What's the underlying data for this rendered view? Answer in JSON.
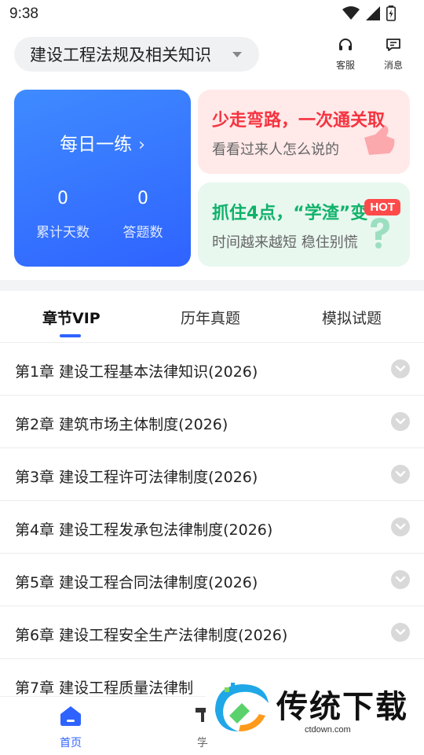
{
  "status_bar": {
    "time": "9:38"
  },
  "header": {
    "subject": "建设工程法规及相关知识",
    "service_label": "客服",
    "message_label": "消息"
  },
  "daily_card": {
    "title": "每日一练",
    "stats": [
      {
        "value": "0",
        "caption": "累计天数"
      },
      {
        "value": "0",
        "caption": "答题数"
      }
    ]
  },
  "promos": [
    {
      "title": "少走弯路，一次通关取",
      "subtitle": "看看过来人怎么说的"
    },
    {
      "title": "抓住4点，“学渣”变",
      "subtitle": "时间越来越短 稳住别慌",
      "badge": "HOT"
    }
  ],
  "tabs": [
    {
      "label": "章节VIP",
      "active": true
    },
    {
      "label": "历年真题",
      "active": false
    },
    {
      "label": "模拟试题",
      "active": false
    }
  ],
  "chapters": [
    "第1章  建设工程基本法律知识(2026)",
    "第2章  建筑市场主体制度(2026)",
    "第3章  建设工程许可法律制度(2026)",
    "第4章  建设工程发承包法律制度(2026)",
    "第5章  建设工程合同法律制度(2026)",
    "第6章  建设工程安全生产法律制度(2026)",
    "第7章  建设工程质量法律制"
  ],
  "bottom_nav": [
    {
      "label": "首页",
      "icon": "home-icon",
      "active": true
    },
    {
      "label": "学",
      "icon": "study-icon",
      "active": false
    }
  ],
  "watermark": {
    "title": "传统下载",
    "url": "ctdown.com"
  },
  "colors": {
    "accent": "#2f63ff",
    "promo_red": "#f5333f",
    "promo_green": "#11b26b",
    "hot": "#ff4a4a"
  }
}
